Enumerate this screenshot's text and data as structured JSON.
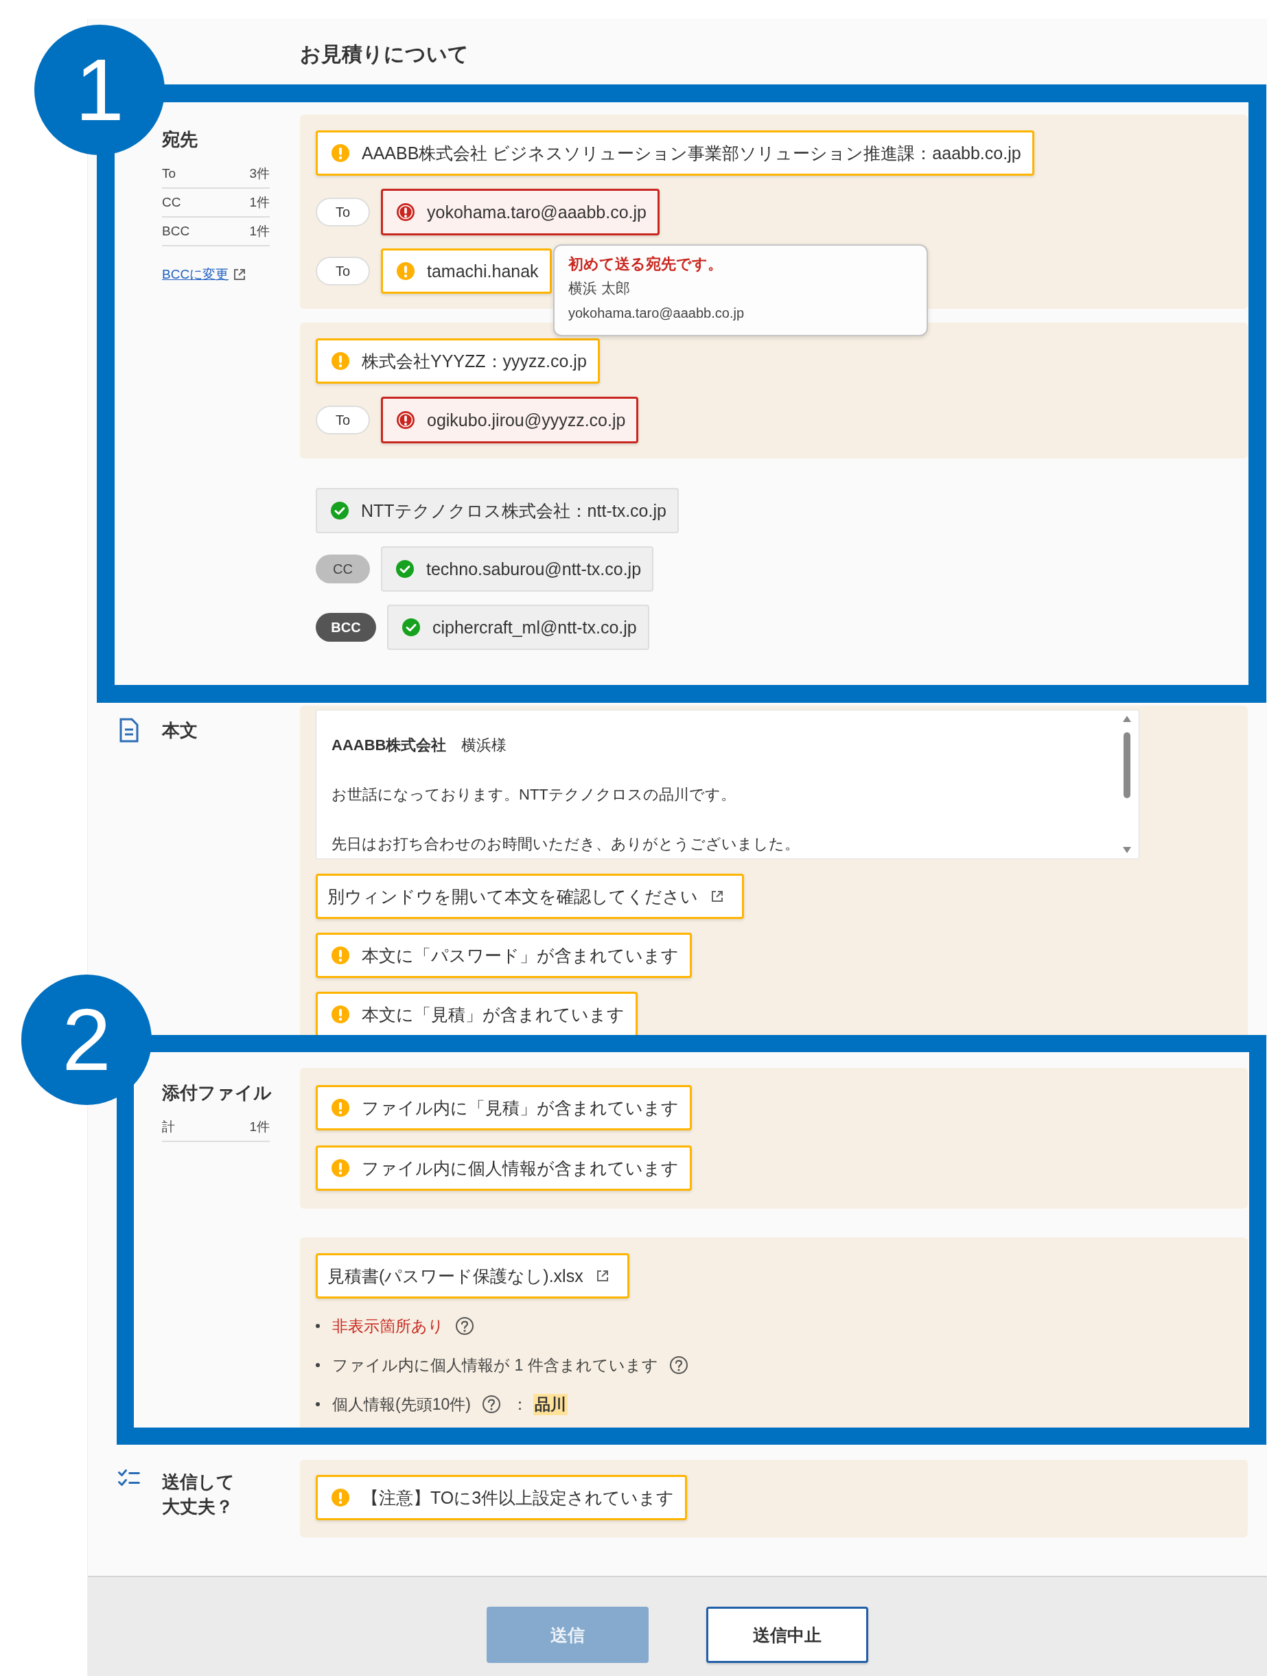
{
  "title": "お見積りについて",
  "callouts": [
    {
      "number": "1"
    },
    {
      "number": "2"
    }
  ],
  "recipients": {
    "label": "宛先",
    "counts": [
      {
        "type": "To",
        "count": "3件"
      },
      {
        "type": "CC",
        "count": "1件"
      },
      {
        "type": "BCC",
        "count": "1件"
      }
    ],
    "link": "BCCに変更",
    "groups": [
      {
        "domain": {
          "kind": "warning",
          "text": "AAABB株式会社 ビジネスソリューション事業部ソリューション推進課：aaabb.co.jp"
        },
        "addresses": [
          {
            "kind": "error",
            "field": {
              "kind": "to",
              "label": "To"
            },
            "address": "yokohama.taro@aaabb.co.jp"
          },
          {
            "kind": "warning",
            "field": {
              "kind": "to",
              "label": "To"
            },
            "address": "tamachi.hanak"
          }
        ]
      },
      {
        "domain": {
          "kind": "warning",
          "text": "株式会社YYYZZ：yyyzz.co.jp"
        },
        "addresses": [
          {
            "kind": "error",
            "field": {
              "kind": "to",
              "label": "To"
            },
            "address": "ogikubo.jirou@yyyzz.co.jp"
          }
        ]
      },
      {
        "domain": {
          "kind": "ok",
          "text": "NTTテクノクロス株式会社：ntt-tx.co.jp"
        },
        "addresses": [
          {
            "kind": "ok",
            "field": {
              "kind": "cc",
              "label": "CC"
            },
            "address": "techno.saburou@ntt-tx.co.jp"
          },
          {
            "kind": "ok",
            "field": {
              "kind": "bcc",
              "label": "BCC"
            },
            "address": "ciphercraft_ml@ntt-tx.co.jp"
          }
        ]
      }
    ]
  },
  "tooltip": {
    "title": "初めて送る宛先です。",
    "name": "横浜 太郎",
    "email": "yokohama.taro@aaabb.co.jp"
  },
  "body": {
    "label": "本文",
    "lines": [
      "**AAABB株式会社**　横浜様",
      "お世話になっております。NTTテクノクロスの品川です。",
      "先日はお打ち合わせのお時間いただき、ありがとうございました。"
    ],
    "notices": [
      {
        "kind": "link",
        "text": "別ウィンドウを開いて本文を確認してください"
      },
      {
        "kind": "warning",
        "text": "本文に「パスワード」が含まれています"
      },
      {
        "kind": "warning",
        "text": "本文に「見積」が含まれています"
      }
    ]
  },
  "attachments": {
    "label": "添付ファイル",
    "total_label": "計",
    "total": "1件",
    "warnings": [
      {
        "kind": "warning",
        "text": "ファイル内に「見積」が含まれています"
      },
      {
        "kind": "warning",
        "text": "ファイル内に個人情報が含まれています"
      }
    ],
    "file": {
      "name": "見積書(パスワード保護なし).xlsx"
    },
    "details": [
      {
        "kind": "alert",
        "text": "非表示箇所あり",
        "help": true
      },
      {
        "kind": "info",
        "text": "ファイル内に個人情報が 1 件含まれています",
        "help": true
      },
      {
        "kind": "info",
        "text": "個人情報(先頭10件)",
        "help": true,
        "separator": "：",
        "value": "品川"
      }
    ]
  },
  "check": {
    "label_lines": [
      "送信して",
      "大丈夫？"
    ],
    "notices": [
      {
        "kind": "warning",
        "text": "【注意】TOに3件以上設定されています"
      }
    ]
  },
  "buttons": [
    {
      "kind": "primary",
      "label": "送信",
      "disabled": true
    },
    {
      "kind": "secondary",
      "label": "送信中止",
      "disabled": false
    }
  ]
}
